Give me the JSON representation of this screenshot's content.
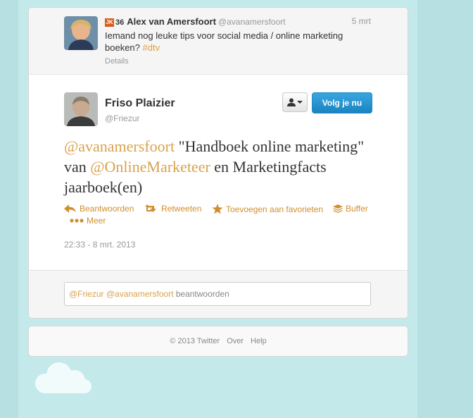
{
  "parent_tweet": {
    "badge": "JK",
    "score": "36",
    "name": "Alex van Amersfoort",
    "handle": "@avanamersfoort",
    "time": "5 mrt",
    "text": "Iemand nog leuke tips voor social media / online marketing boeken?",
    "hashtag": "#dtv",
    "details_label": "Details"
  },
  "tweet": {
    "name": "Friso Plaizier",
    "handle": "@Friezur",
    "follow_label": "Volg je nu",
    "text_parts": {
      "mention1": "@avanamersfoort",
      "t1": " \"Handboek online marketing\" van ",
      "mention2": "@OnlineMarketeer",
      "t2": " en Marketingfacts jaarboek(en)"
    },
    "actions": {
      "reply": "Beantwoorden",
      "retweet": "Retweeten",
      "favorite": "Toevoegen aan favorieten",
      "buffer": "Buffer",
      "more": "Meer"
    },
    "timestamp": "22:33 - 8 mrt. 2013"
  },
  "reply_box": {
    "mentions": "@Friezur @avanamersfoort",
    "placeholder_suffix": " beantwoorden"
  },
  "footer": {
    "copyright": "© 2013 Twitter",
    "about": "Over",
    "help": "Help"
  },
  "colors": {
    "accent": "#d9a24d",
    "action": "#d08f2e",
    "follow": "#2b9bd8",
    "background": "#b6e0e2"
  },
  "icons": [
    "user-icon",
    "caret-down-icon",
    "reply-icon",
    "retweet-icon",
    "star-icon",
    "buffer-icon",
    "more-icon"
  ]
}
